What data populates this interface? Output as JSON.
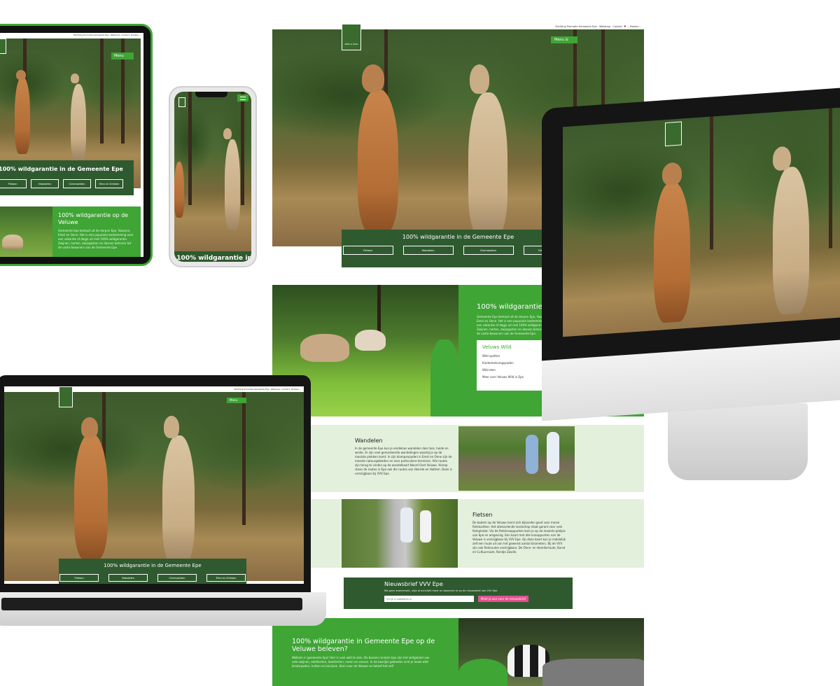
{
  "nav": {
    "top_links": [
      "Stichting Promotie Gemeente Epe",
      "Webshop",
      "Contact"
    ],
    "search_label": "Zoeken...",
    "menu_label": "Menu",
    "logo_text": "ZIEN & WILD"
  },
  "hero": {
    "title": "100% wildgarantie in de Gemeente Epe",
    "buttons": [
      "Fietsen",
      "Wandelen",
      "Overnachten",
      "Eten en Drinken"
    ]
  },
  "phone_hero_title": "100% wildgarantie in",
  "intro": {
    "title": "100% wildgarantie op de Veluwe",
    "title_short": "100% wildgarantie op d",
    "text": "Gemeente Epe bestaat uit de dorpen Epe, Vaassen, Emst en Oene. Het is een populaire bestemming voor een vakantie of dagje uit met 100% wildgarantie. Zwijnen, herten, zwijngasten en dassen behoren tot de vaste bewoners van de Gemeente Epe."
  },
  "veluws_wild": {
    "title": "Veluws Wild",
    "items": [
      "Wild spotten",
      "Kinderbelevingspaden",
      "Wild eten",
      "Meer over Veluws Wild in Epe"
    ]
  },
  "wandelen": {
    "title": "Wandelen",
    "text": "In de gemeente Epe kun je eindeloos wandelen door bos, heide en weide. Er zijn veel gemarkeerde wandelingen waarbij je op de mooiste plekken komt. In zijn klompenpaden in Emst en Oene zijn de meeste natuurgebieden en over particuliere terreinen. Alle routes zijn terug te vinden op de wandelkaart Noord Oost Veluwe. Hierop staan de routes in Epe ook die routes van Heerde en Hattem. Deze is verkrijgbaar bij VVV Epe."
  },
  "fietsen": {
    "title": "Fietsen",
    "text": "De bodem op de Veluwe leent zich bijzonder goed voor mooie fietstochten. Het afwisselende landschap staat garant voor vele fietsplezier. Via de fietsknooppunten kom je op de mooiste plekjes van Epe en omgeving. Een kaart met alle knooppunten van de Veluwe is verkrijgbaar bij VVV Epe. Op deze kaart kun je makkelijk zelf een route uit van het gewenst aantal kilometers. Bij de VVV zijn ook fietsroutes verkrijgbaar. De Oene- en Heerderroute, Kunst en Cultuurroute, Rondje Zwolle."
  },
  "newsletter": {
    "title": "Nieuwsbrief VVV Epe",
    "subtitle": "Mis geen evenement, uitje of activiteit meer en abonneer je op de nieuwsbrief van VVV Epe.",
    "placeholder": "Vul je e-mailadres in",
    "button": "Meld je aan voor de nieuwsbrief"
  },
  "bottom": {
    "title": "100% wildgarantie in Gemeente Epe op de Veluwe beleven?",
    "text": "Welkom in gemeente Epe! Hier is veel wild te zien. De bossen rondom Epe zijn het leefgebied van vele zwijnen, edelherten, damherten, reeen en vossen. In de bosrijke gebieden vind je leuke wild kinderpaden, hutten en konijnen. Kom naar de Veluwe en beleef het zelf."
  },
  "colors": {
    "green": "#3fa535",
    "dark_green": "#2f5a2f",
    "light_green": "#e3f1dc",
    "pink": "#e2508f"
  }
}
